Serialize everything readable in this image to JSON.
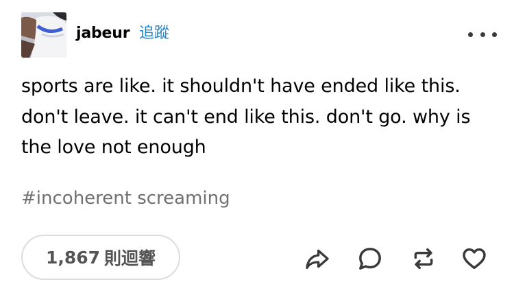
{
  "post": {
    "author": {
      "username": "jabeur",
      "follow_label": "追蹤"
    },
    "body": "sports are like. it shouldn't have ended like this. don't leave. it can't end like this. don't go. why is the love not enough",
    "tags": [
      "#incoherent screaming"
    ],
    "notes": {
      "count": "1,867",
      "label": "則迴響"
    },
    "actions": {
      "more": "more-options-icon",
      "share": "share-icon",
      "reply": "reply-icon",
      "reblog": "reblog-icon",
      "like": "heart-icon"
    }
  },
  "colors": {
    "accent": "#1a88d6",
    "text": "#000000",
    "muted": "#707070",
    "icon": "#3a3a3a",
    "pill_border": "#dcdcdc"
  }
}
